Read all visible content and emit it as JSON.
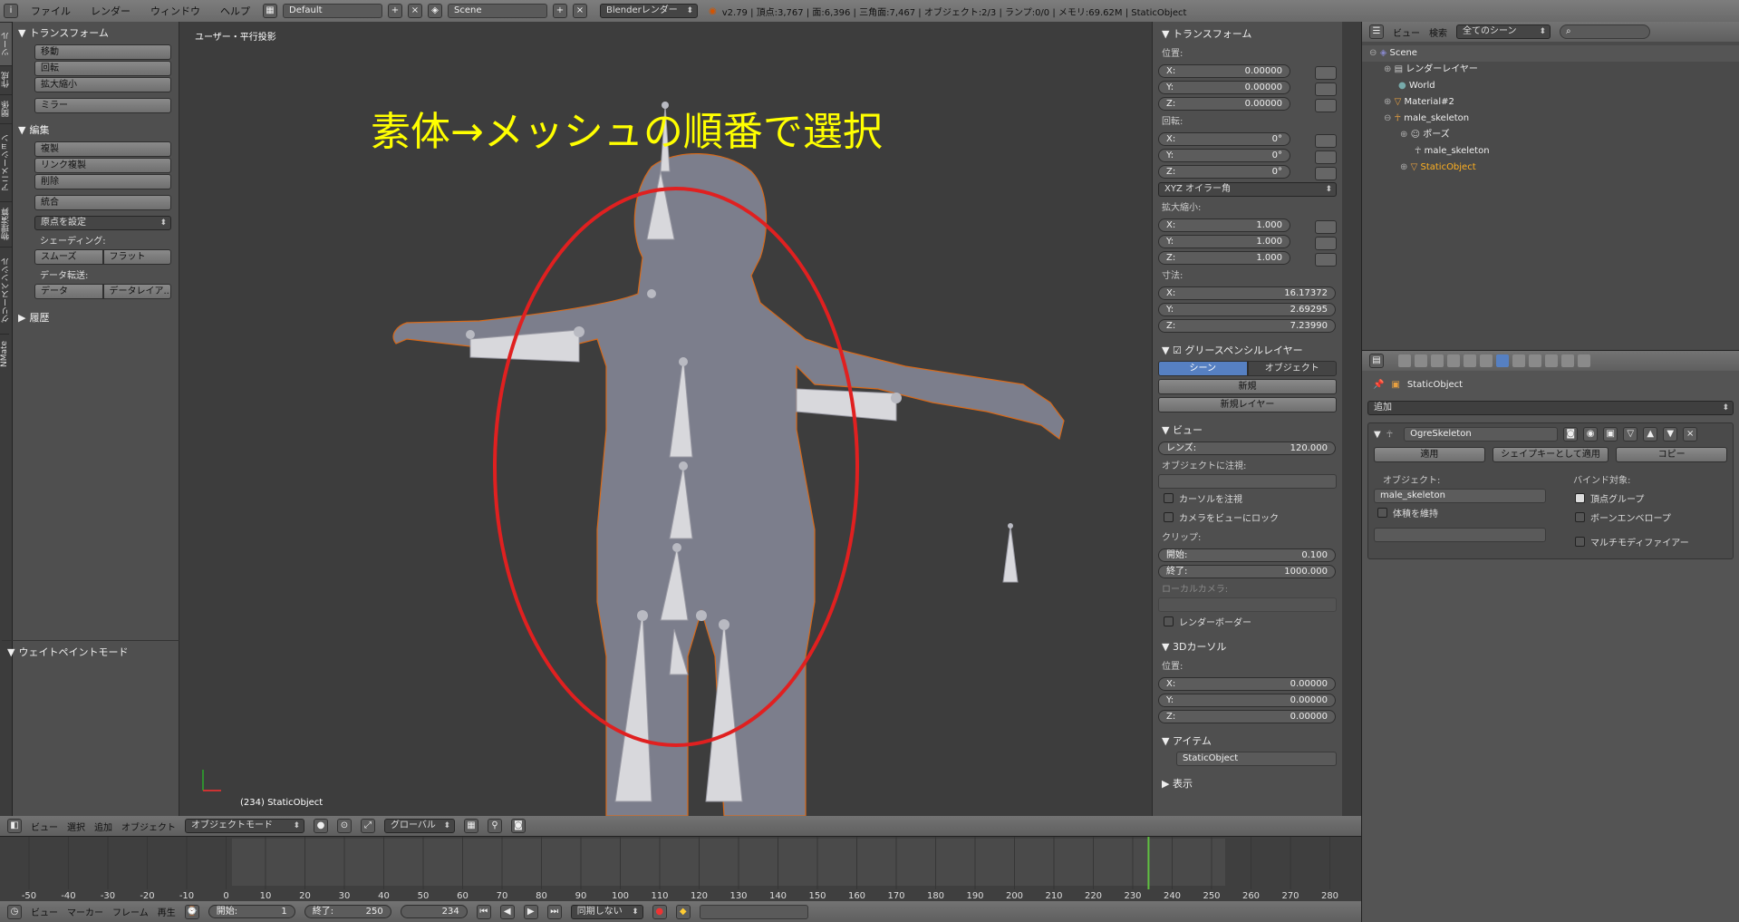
{
  "topbar": {
    "menus": [
      "ファイル",
      "レンダー",
      "ウィンドウ",
      "ヘルプ"
    ],
    "layout": "Default",
    "scene": "Scene",
    "engine": "Blenderレンダー",
    "stats": "v2.79 | 頂点:3,767 | 面:6,396 | 三角面:7,467 | オブジェクト:2/3 | ランプ:0/0 | メモリ:69.62M | StaticObject"
  },
  "toolshelf": {
    "tabs": [
      "ツール",
      "作成",
      "関係",
      "アニメーション",
      "物理演算",
      "グリースペンシル",
      "NMate"
    ],
    "transform_header": "トランスフォーム",
    "transform_buttons": [
      "移動",
      "回転",
      "拡大縮小"
    ],
    "mirror": "ミラー",
    "edit_header": "編集",
    "edit_buttons": [
      "複製",
      "リンク複製",
      "削除"
    ],
    "join": "統合",
    "set_origin": "原点を設定",
    "shading_label": "シェーディング:",
    "smooth": "スムーズ",
    "flat": "フラット",
    "data_transfer_label": "データ転送:",
    "data": "データ",
    "data_layout": "データレイア...",
    "history": "履歴",
    "weight_paint": "ウェイトペイントモード"
  },
  "viewport": {
    "view_name": "ユーザー・平行投影",
    "annotation": "素体→メッシュの順番で選択",
    "object_info": "(234) StaticObject",
    "accent_red": "#e02020",
    "annotation_color": "#ffff00"
  },
  "npanel": {
    "transform": "トランスフォーム",
    "location_label": "位置:",
    "location": [
      {
        "axis": "X:",
        "v": "0.00000"
      },
      {
        "axis": "Y:",
        "v": "0.00000"
      },
      {
        "axis": "Z:",
        "v": "0.00000"
      }
    ],
    "rotation_label": "回転:",
    "rotation": [
      {
        "axis": "X:",
        "v": "0°"
      },
      {
        "axis": "Y:",
        "v": "0°"
      },
      {
        "axis": "Z:",
        "v": "0°"
      }
    ],
    "rot_mode": "XYZ オイラー角",
    "scale_label": "拡大縮小:",
    "scale": [
      {
        "axis": "X:",
        "v": "1.000"
      },
      {
        "axis": "Y:",
        "v": "1.000"
      },
      {
        "axis": "Z:",
        "v": "1.000"
      }
    ],
    "dims_label": "寸法:",
    "dims": [
      {
        "axis": "X:",
        "v": "16.17372"
      },
      {
        "axis": "Y:",
        "v": "2.69295"
      },
      {
        "axis": "Z:",
        "v": "7.23990"
      }
    ],
    "gp_layer": "グリースペンシルレイヤー",
    "scene_btn": "シーン",
    "object_btn": "オブジェクト",
    "new": "新規",
    "new_layer": "新規レイヤー",
    "view": "ビュー",
    "lens_label": "レンズ:",
    "lens": "120.000",
    "lock_obj": "オブジェクトに注視:",
    "lock_cursor": "カーソルを注視",
    "lock_camera": "カメラをビューにロック",
    "clip_label": "クリップ:",
    "clip_start_label": "開始:",
    "clip_start": "0.100",
    "clip_end_label": "終了:",
    "clip_end": "1000.000",
    "local_camera": "ローカルカメラ:",
    "render_border": "レンダーボーダー",
    "cursor3d": "3Dカーソル",
    "cursor_loc_label": "位置:",
    "cursor": [
      {
        "axis": "X:",
        "v": "0.00000"
      },
      {
        "axis": "Y:",
        "v": "0.00000"
      },
      {
        "axis": "Z:",
        "v": "0.00000"
      }
    ],
    "item": "アイテム",
    "item_name": "StaticObject",
    "display": "表示"
  },
  "outliner": {
    "view": "ビュー",
    "search": "検索",
    "filter": "全てのシーン",
    "rows": [
      {
        "name": "Scene",
        "indent": 0
      },
      {
        "name": "レンダーレイヤー",
        "indent": 1
      },
      {
        "name": "World",
        "indent": 1
      },
      {
        "name": "Material#2",
        "indent": 1
      },
      {
        "name": "male_skeleton",
        "indent": 1
      },
      {
        "name": "ポーズ",
        "indent": 2
      },
      {
        "name": "male_skeleton",
        "indent": 2
      },
      {
        "name": "StaticObject",
        "indent": 2
      }
    ]
  },
  "properties": {
    "object": "StaticObject",
    "add": "追加",
    "modifier_name": "OgreSkeleton",
    "apply": "適用",
    "apply_shapekey": "シェイプキーとして適用",
    "copy": "コピー",
    "object_label": "オブジェクト:",
    "object_value": "male_skeleton",
    "keep_volume": "体積を維持",
    "bind_label": "バインド対象:",
    "vertex_groups": "頂点グループ",
    "bone_envelope": "ボーンエンベロープ",
    "multi_modifier": "マルチモディファイアー"
  },
  "viewport_header": {
    "menus": [
      "ビュー",
      "選択",
      "追加",
      "オブジェクト"
    ],
    "mode": "オブジェクトモード",
    "orientation": "グローバル"
  },
  "timeline": {
    "ticks": [
      "-50",
      "-40",
      "-30",
      "-20",
      "-10",
      "0",
      "10",
      "20",
      "30",
      "40",
      "50",
      "60",
      "70",
      "80",
      "90",
      "100",
      "110",
      "120",
      "130",
      "140",
      "150",
      "160",
      "170",
      "180",
      "190",
      "200",
      "210",
      "220",
      "230",
      "240",
      "250",
      "260",
      "270",
      "280"
    ],
    "current_frame": 234,
    "menus": [
      "ビュー",
      "マーカー",
      "フレーム",
      "再生"
    ],
    "start_label": "開始:",
    "start": "1",
    "end_label": "終了:",
    "end": "250",
    "frame": "234",
    "sync": "同期しない"
  }
}
